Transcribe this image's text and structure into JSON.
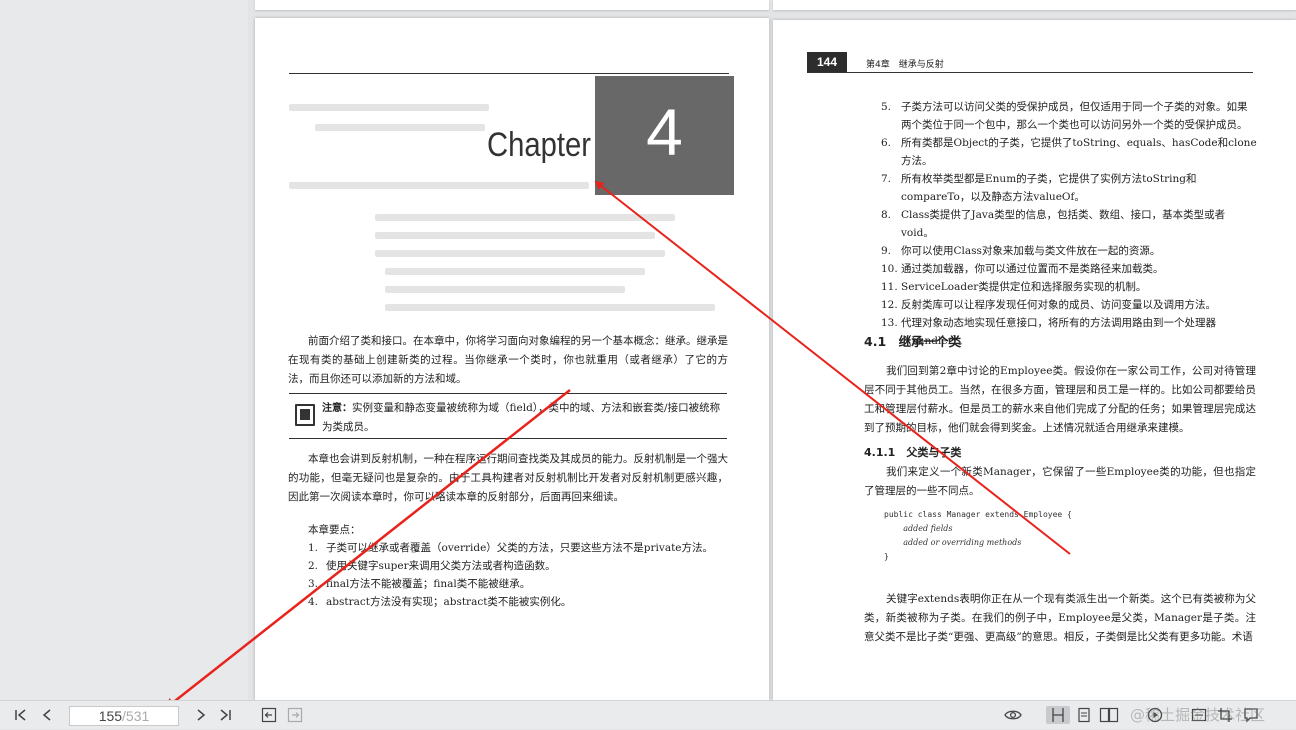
{
  "toolbar": {
    "current_page": "155",
    "total_pages": "/531",
    "icons": [
      "first-page-icon",
      "prev-page-icon",
      "next-page-icon",
      "last-page-icon",
      "back-icon",
      "forward-icon",
      "eye-icon",
      "single-page-icon",
      "continuous-page-icon",
      "two-page-icon",
      "play-icon",
      "fit-width-icon",
      "crop-icon",
      "comment-icon"
    ],
    "watermark": "@稀土掘金技术社区"
  },
  "left_page": {
    "chapter_word": "Chapter",
    "chapter_number": "4",
    "intro": "前面介绍了类和接口。在本章中，你将学习面向对象编程的另一个基本概念：继承。继承是在现有类的基础上创建新类的过程。当你继承一个类时，你也就重用（或者继承）了它的方法，而且你还可以添加新的方法和域。",
    "note_label": "注意：",
    "note_text": "实例变量和静态变量被统称为域（field），类中的域、方法和嵌套类/接口被统称为类成员。",
    "para2": "本章也会讲到反射机制，一种在程序运行期间查找类及其成员的能力。反射机制是一个强大的功能，但毫无疑问也是复杂的。由于工具构建者对反射机制比开发者对反射机制更感兴趣，因此第一次阅读本章时，你可以略读本章的反射部分，后面再回来细读。",
    "points_head": "本章要点：",
    "points": [
      {
        "n": "1.",
        "t": "子类可以继承或者覆盖（override）父类的方法，只要这些方法不是private方法。"
      },
      {
        "n": "2.",
        "t": "使用关键字super来调用父类方法或者构造函数。"
      },
      {
        "n": "3.",
        "t": "final方法不能被覆盖；final类不能被继承。"
      },
      {
        "n": "4.",
        "t": "abstract方法没有实现；abstract类不能被实例化。"
      }
    ]
  },
  "right_page": {
    "page_number": "144",
    "running_head": "第4章　继承与反射",
    "points": [
      {
        "n": "5.",
        "t": "子类方法可以访问父类的受保护成员，但仅适用于同一个子类的对象。如果两个类位于同一个包中，那么一个类也可以访问另外一个类的受保护成员。"
      },
      {
        "n": "6.",
        "t": "所有类都是Object的子类，它提供了toString、equals、hasCode和clone方法。"
      },
      {
        "n": "7.",
        "t": "所有枚举类型都是Enum的子类，它提供了实例方法toString和compareTo，以及静态方法valueOf。"
      },
      {
        "n": "8.",
        "t": "Class类提供了Java类型的信息，包括类、数组、接口，基本类型或者void。"
      },
      {
        "n": "9.",
        "t": "你可以使用Class对象来加载与类文件放在一起的资源。"
      },
      {
        "n": "10.",
        "t": "通过类加载器，你可以通过位置而不是类路径来加载类。"
      },
      {
        "n": "11.",
        "t": "ServiceLoader类提供定位和选择服务实现的机制。"
      },
      {
        "n": "12.",
        "t": "反射类库可以让程序发现任何对象的成员、访问变量以及调用方法。"
      },
      {
        "n": "13.",
        "t": "代理对象动态地实现任意接口，将所有的方法调用路由到一个处理器（handler）。"
      }
    ],
    "section_title": "4.1　继承一个类",
    "section_para": "我们回到第2章中讨论的Employee类。假设你在一家公司工作，公司对待管理层不同于其他员工。当然，在很多方面，管理层和员工是一样的。比如公司都要给员工和管理层付薪水。但是员工的薪水来自他们完成了分配的任务；如果管理层完成达到了预期的目标，他们就会得到奖金。上述情况就适合用继承来建模。",
    "subsection_title": "4.1.1　父类与子类",
    "subsection_para": "我们来定义一个新类Manager，它保留了一些Employee类的功能，但也指定了管理层的一些不同点。",
    "code_line1": "public class Manager extends Employee {",
    "code_line2": "added fields",
    "code_line3": "added or overriding methods",
    "code_line4": "}",
    "closing_para": "关键字extends表明你正在从一个现有类派生出一个新类。这个已有类被称为父类，新类被称为子类。在我们的例子中，Employee是父类，Manager是子类。注意父类不是比子类“更强、更高级”的意思。相反，子类倒是比父类有更多功能。术语"
  },
  "annotation_color": "#e8231c"
}
